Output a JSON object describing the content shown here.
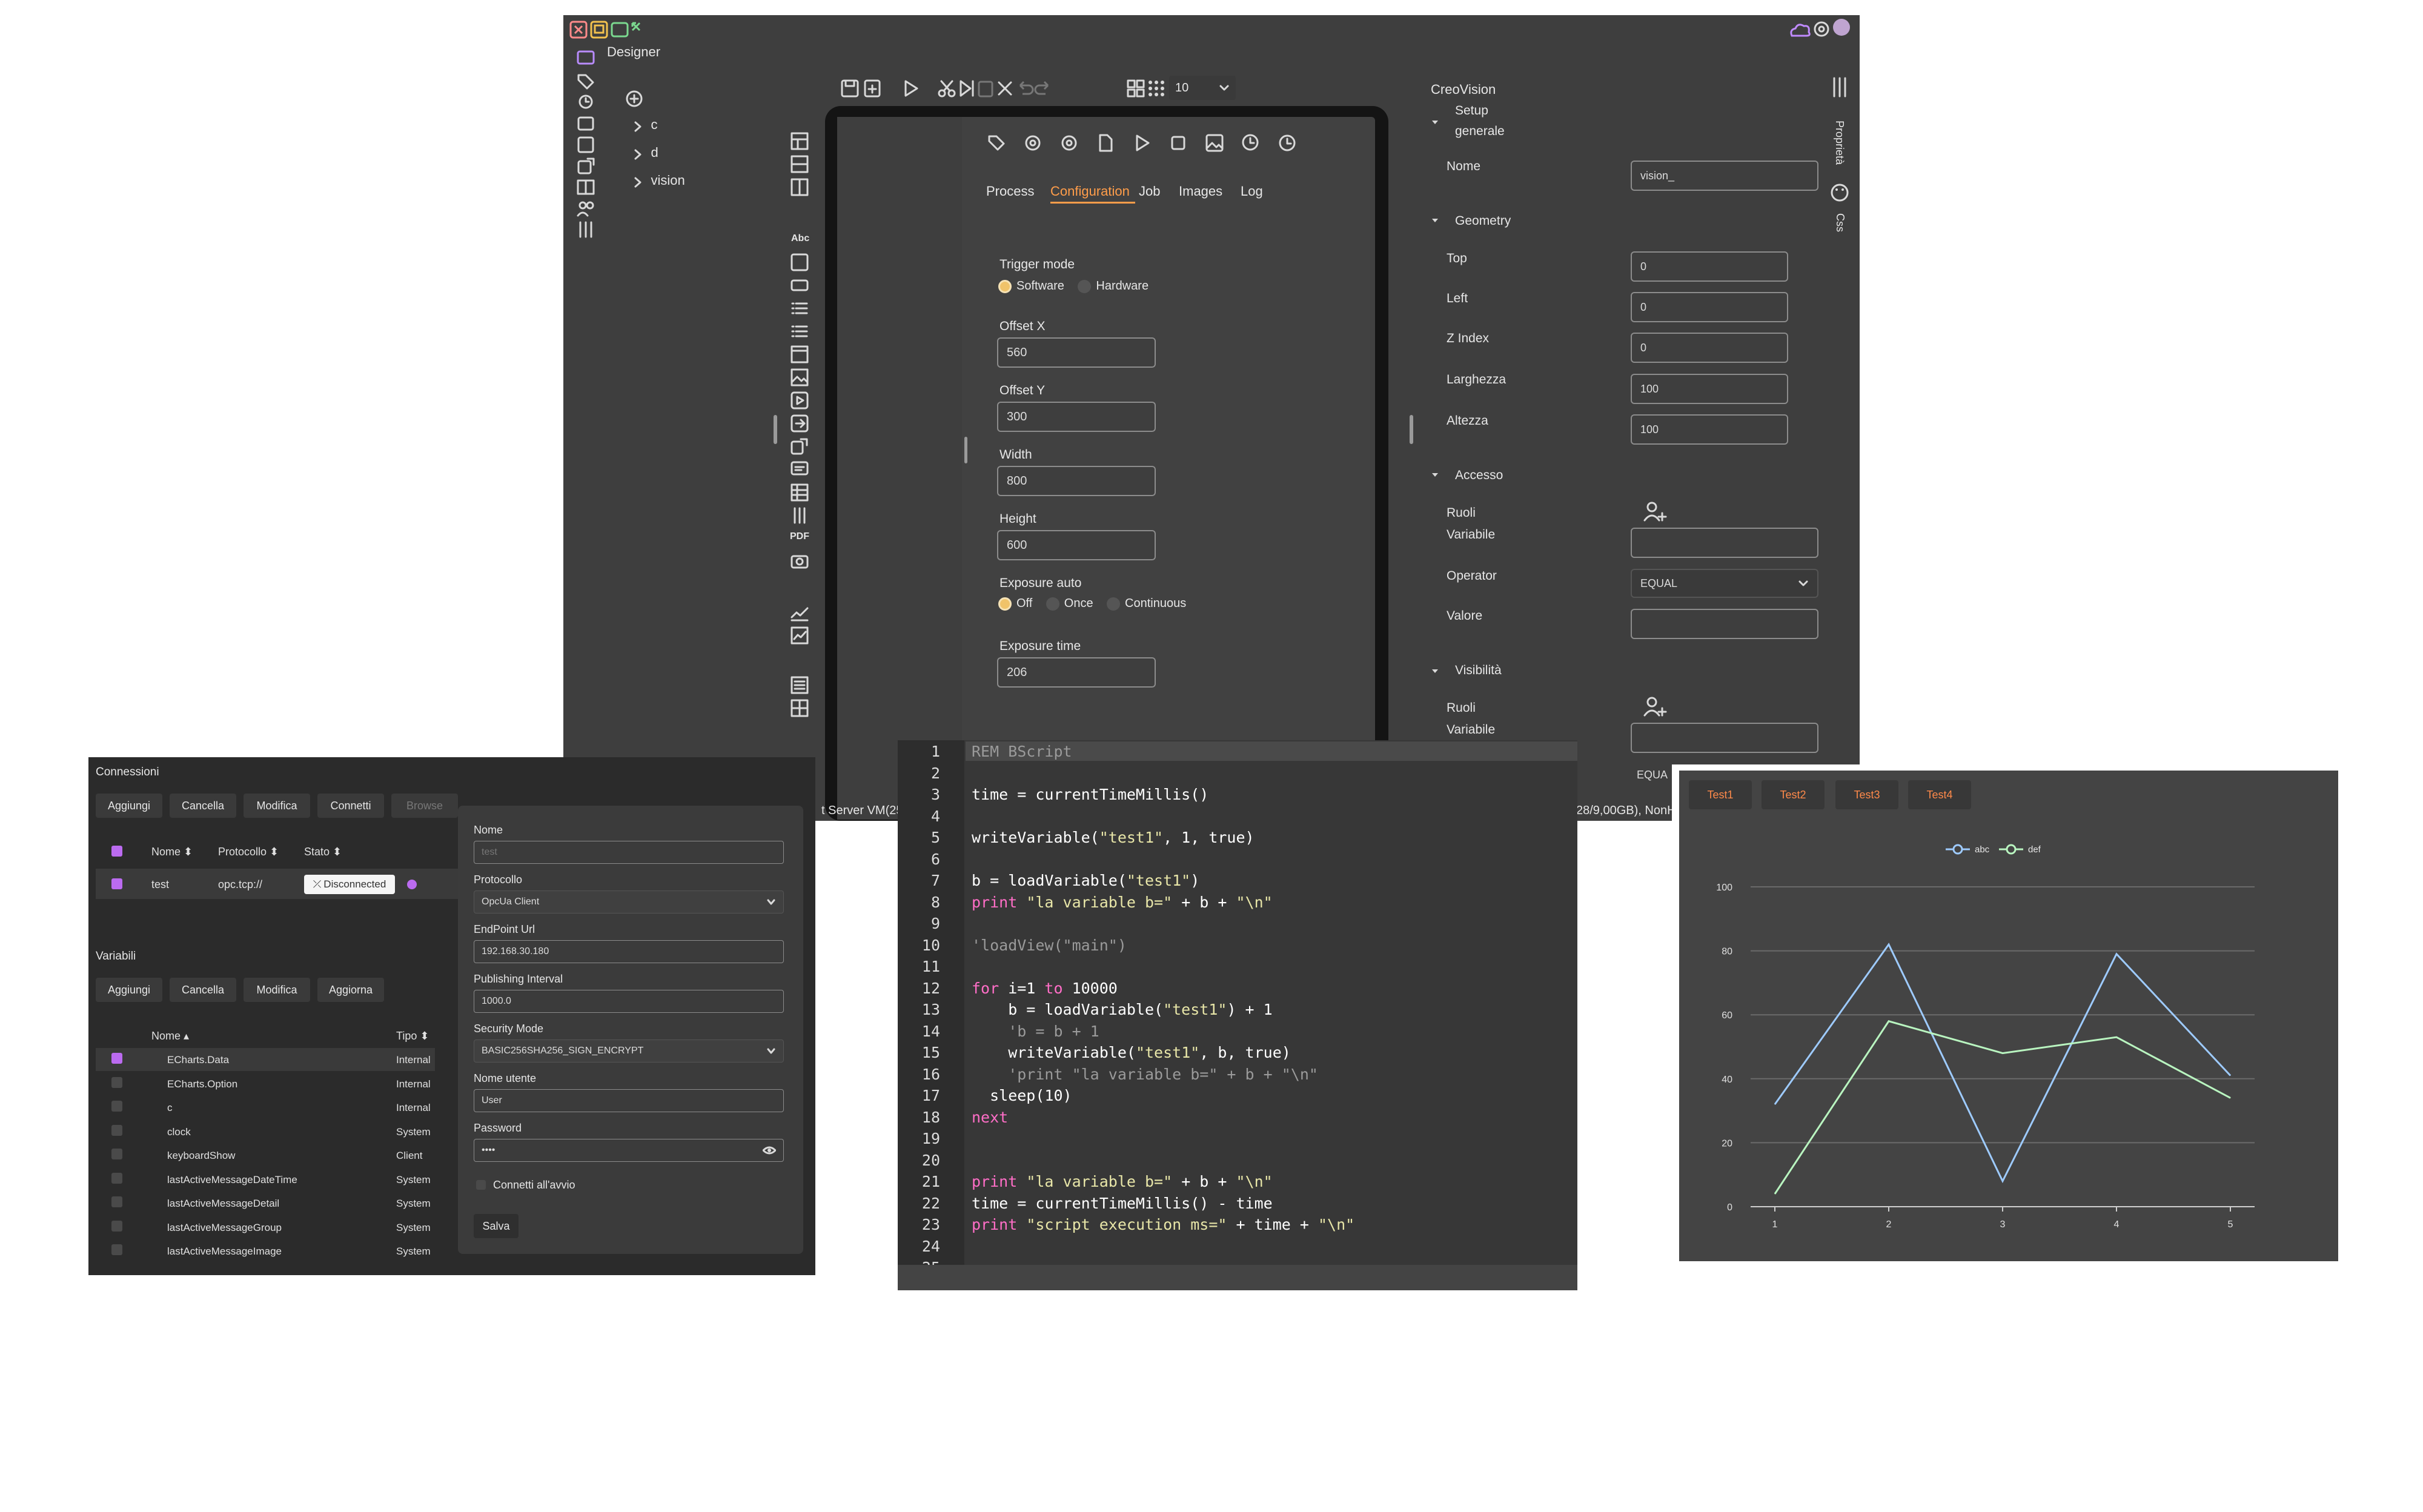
{
  "designer": {
    "title": "Designer",
    "tree": [
      "c",
      "d",
      "vision"
    ],
    "zoom_value": "10",
    "tablet": {
      "tabs": [
        "Process",
        "Configuration",
        "Job",
        "Images",
        "Log"
      ],
      "active_tab": "Configuration",
      "trigger_mode_label": "Trigger mode",
      "trigger_options": [
        "Software",
        "Hardware"
      ],
      "offset_x_label": "Offset X",
      "offset_x": "560",
      "offset_y_label": "Offset Y",
      "offset_y": "300",
      "width_label": "Width",
      "width": "800",
      "height_label": "Height",
      "height": "600",
      "exposure_auto_label": "Exposure auto",
      "exposure_options": [
        "Off",
        "Once",
        "Continuous"
      ],
      "exposure_time_label": "Exposure time",
      "exposure_time": "206"
    },
    "props": {
      "app_name": "CreoVision",
      "setup_label_1": "Setup",
      "setup_label_2": "generale",
      "nome_label": "Nome",
      "nome_value": "vision_",
      "geometry_label": "Geometry",
      "top_label": "Top",
      "top_value": "0",
      "left_label": "Left",
      "left_value": "0",
      "zindex_label": "Z Index",
      "zindex_value": "0",
      "larghezza_label": "Larghezza",
      "larghezza_value": "100",
      "altezza_label": "Altezza",
      "altezza_value": "100",
      "accesso_label": "Accesso",
      "ruoli_label": "Ruoli",
      "variabile_label": "Variabile",
      "operator_label": "Operator",
      "operator_value": "EQUAL",
      "valore_label": "Valore",
      "visibilita_label": "Visibilità",
      "ruoli2_label": "Ruoli",
      "variabile2_label": "Variabile",
      "operator2_value": "EQUA",
      "side_tab_1": "Proprietà",
      "side_tab_2": "Css"
    },
    "status_left": "t Server VM(25.",
    "status_right": "28/9,00GB), NonHe"
  },
  "connections": {
    "title": "Connessioni",
    "buttons": [
      "Aggiungi",
      "Cancella",
      "Modifica",
      "Connetti",
      "Browse"
    ],
    "columns": [
      "Nome",
      "Protocollo",
      "Stato"
    ],
    "row": {
      "nome": "test",
      "protocollo": "opc.tcp://",
      "stato": "Disconnected"
    },
    "variables_title": "Variabili",
    "var_buttons": [
      "Aggiungi",
      "Cancella",
      "Modifica",
      "Aggiorna"
    ],
    "var_columns": [
      "Nome",
      "Tipo"
    ],
    "variables": [
      {
        "nome": "ECharts.Data",
        "tipo": "Internal"
      },
      {
        "nome": "ECharts.Option",
        "tipo": "Internal"
      },
      {
        "nome": "c",
        "tipo": "Internal"
      },
      {
        "nome": "clock",
        "tipo": "System"
      },
      {
        "nome": "keyboardShow",
        "tipo": "Client"
      },
      {
        "nome": "lastActiveMessageDateTime",
        "tipo": "System"
      },
      {
        "nome": "lastActiveMessageDetail",
        "tipo": "System"
      },
      {
        "nome": "lastActiveMessageGroup",
        "tipo": "System"
      },
      {
        "nome": "lastActiveMessageImage",
        "tipo": "System"
      }
    ],
    "dialog": {
      "nome_label": "Nome",
      "nome_value": "test",
      "protocollo_label": "Protocollo",
      "protocollo_value": "OpcUa Client",
      "endpoint_label": "EndPoint Url",
      "endpoint_value": "192.168.30.180",
      "publishing_label": "Publishing Interval",
      "publishing_value": "1000.0",
      "security_label": "Security Mode",
      "security_value": "BASIC256SHA256_SIGN_ENCRYPT",
      "user_label": "Nome utente",
      "user_value": "User",
      "password_label": "Password",
      "password_value": "••••",
      "autoconnect_label": "Connetti all'avvio",
      "save_label": "Salva"
    }
  },
  "code": {
    "lines": [
      "REM BScript",
      "",
      "time = currentTimeMillis()",
      "",
      "writeVariable(\"test1\", 1, true)",
      "",
      "b = loadVariable(\"test1\")",
      "print \"la variable b=\" + b + \"\\n\"",
      "",
      "'loadView(\"main\")",
      "",
      "for i=1 to 10000",
      "    b = loadVariable(\"test1\") + 1",
      "    'b = b + 1",
      "    writeVariable(\"test1\", b, true)",
      "    'print \"la variable b=\" + b + \"\\n\"",
      "  sleep(10)",
      "next",
      "",
      "",
      "print \"la variable b=\" + b + \"\\n\"",
      "time = currentTimeMillis() - time",
      "print \"script execution ms=\" + time + \"\\n\"",
      "",
      ""
    ]
  },
  "chart_panel": {
    "tabs": [
      "Test1",
      "Test2",
      "Test3",
      "Test4"
    ]
  },
  "chart_data": {
    "type": "line",
    "categories": [
      "1",
      "2",
      "3",
      "4",
      "5"
    ],
    "series": [
      {
        "name": "abc",
        "values": [
          32,
          82,
          8,
          79,
          41
        ],
        "color": "#9ecbff"
      },
      {
        "name": "def",
        "values": [
          4,
          58,
          48,
          53,
          34
        ],
        "color": "#b9f5c0"
      }
    ],
    "ylim": [
      0,
      100
    ],
    "yticks": [
      "0",
      "20",
      "40",
      "60",
      "80",
      "100"
    ],
    "legend": "top-center",
    "grid": true
  }
}
